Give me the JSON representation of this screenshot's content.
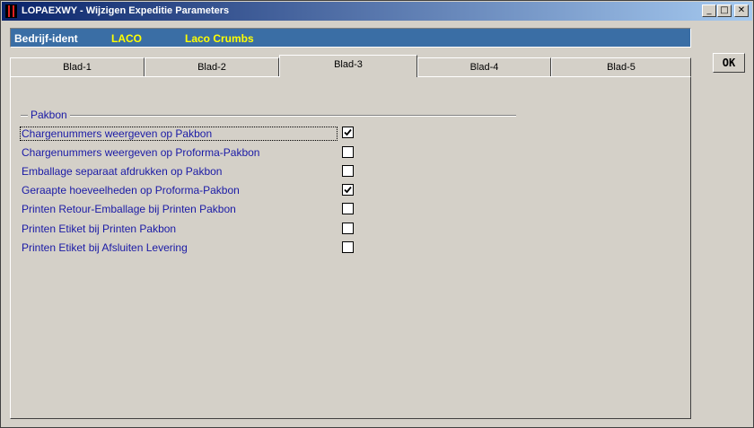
{
  "window": {
    "title": "LOPAEXWY - Wijzigen Expeditie Parameters",
    "controls": {
      "minimize": "_",
      "maximize": "□",
      "close": "✕"
    }
  },
  "header": {
    "label": "Bedrijf-ident",
    "code": "LACO",
    "name": "Laco Crumbs",
    "colors": {
      "band": "#3a6ea5",
      "label": "#ffffff",
      "value": "#ffff00"
    }
  },
  "ok_button": {
    "label": "OK"
  },
  "tabs": [
    {
      "label": "Blad-1",
      "active": false
    },
    {
      "label": "Blad-2",
      "active": false
    },
    {
      "label": "Blad-3",
      "active": true
    },
    {
      "label": "Blad-4",
      "active": false
    },
    {
      "label": "Blad-5",
      "active": false
    }
  ],
  "group": {
    "title": "Pakbon",
    "options": [
      {
        "label": "Chargenummers weergeven op Pakbon",
        "checked": true
      },
      {
        "label": "Chargenummers weergeven op Proforma-Pakbon",
        "checked": false
      },
      {
        "label": "Emballage separaat afdrukken op Pakbon",
        "checked": false
      },
      {
        "label": "Geraapte hoeveelheden op Proforma-Pakbon",
        "checked": true
      },
      {
        "label": "Printen Retour-Emballage bij Printen Pakbon",
        "checked": false
      },
      {
        "label": "Printen Etiket bij Printen Pakbon",
        "checked": false
      },
      {
        "label": "Printen Etiket bij Afsluiten Levering",
        "checked": false
      }
    ]
  }
}
